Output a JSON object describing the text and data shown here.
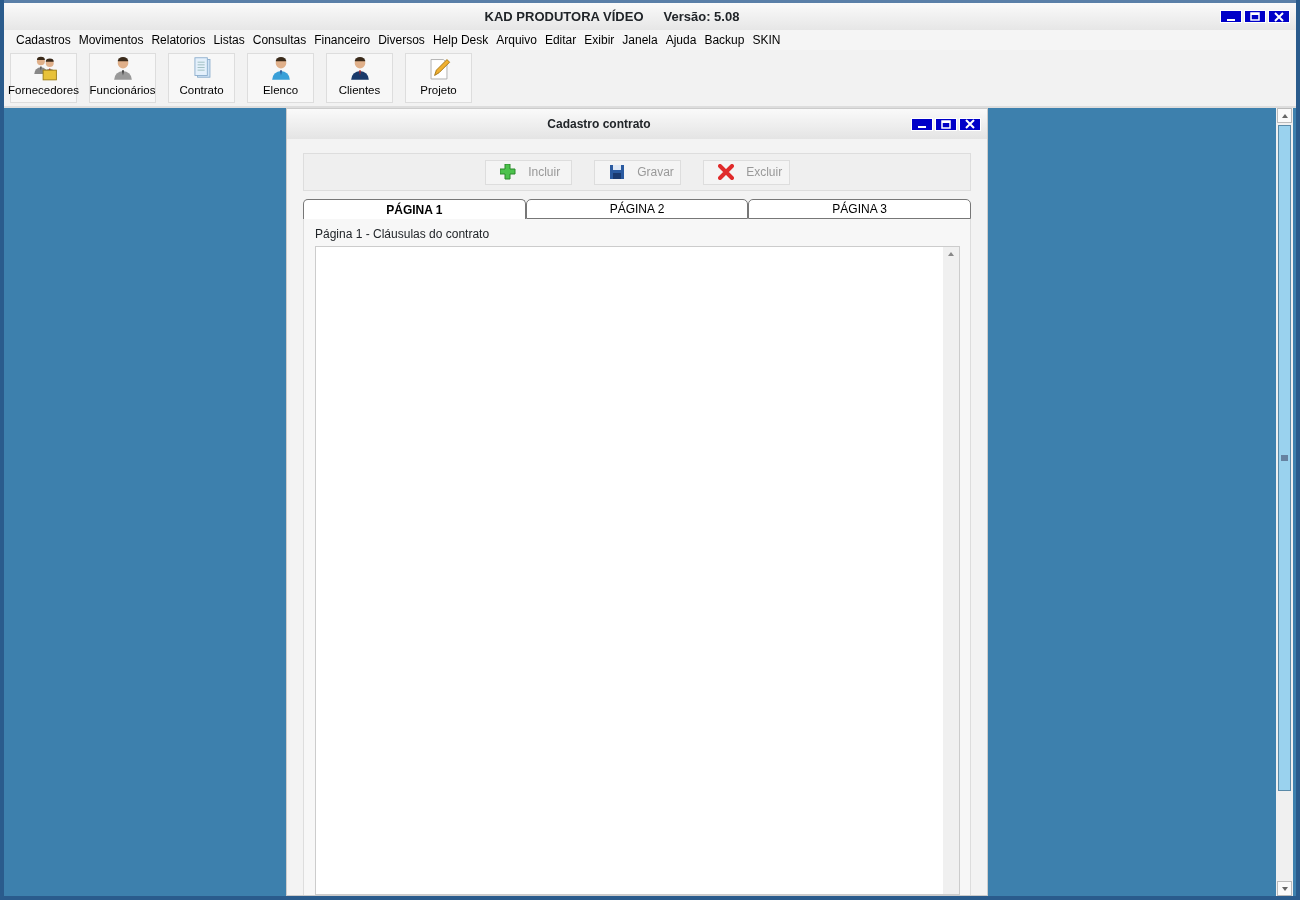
{
  "window": {
    "title": "KAD PRODUTORA VÍDEO",
    "version": "Versão: 5.08"
  },
  "menu": [
    "Cadastros",
    "Movimentos",
    "Relatorios",
    "Listas",
    "Consultas",
    "Financeiro",
    "Diversos",
    "Help Desk",
    "Arquivo",
    "Editar",
    "Exibir",
    "Janela",
    "Ajuda",
    "Backup",
    "SKIN"
  ],
  "toolbar": [
    {
      "label": "Fornecedores",
      "kind": "group"
    },
    {
      "label": "Funcionários",
      "kind": "person"
    },
    {
      "label": "Contrato",
      "kind": "document"
    },
    {
      "label": "Elenco",
      "kind": "person-blue"
    },
    {
      "label": "Clientes",
      "kind": "person-suit"
    },
    {
      "label": "Projeto",
      "kind": "pencil"
    }
  ],
  "child_window": {
    "title": "Cadastro contrato",
    "actions": [
      {
        "label": "Incluir",
        "kind": "add",
        "disabled": true
      },
      {
        "label": "Gravar",
        "kind": "save",
        "disabled": true
      },
      {
        "label": "Excluir",
        "kind": "delete",
        "disabled": true
      }
    ],
    "tabs": [
      {
        "label": "PÁGINA 1",
        "selected": true
      },
      {
        "label": "PÁGINA 2",
        "selected": false
      },
      {
        "label": "PÁGINA 3",
        "selected": false
      }
    ],
    "section_label": "Página 1 - Cláusulas do contrato"
  }
}
